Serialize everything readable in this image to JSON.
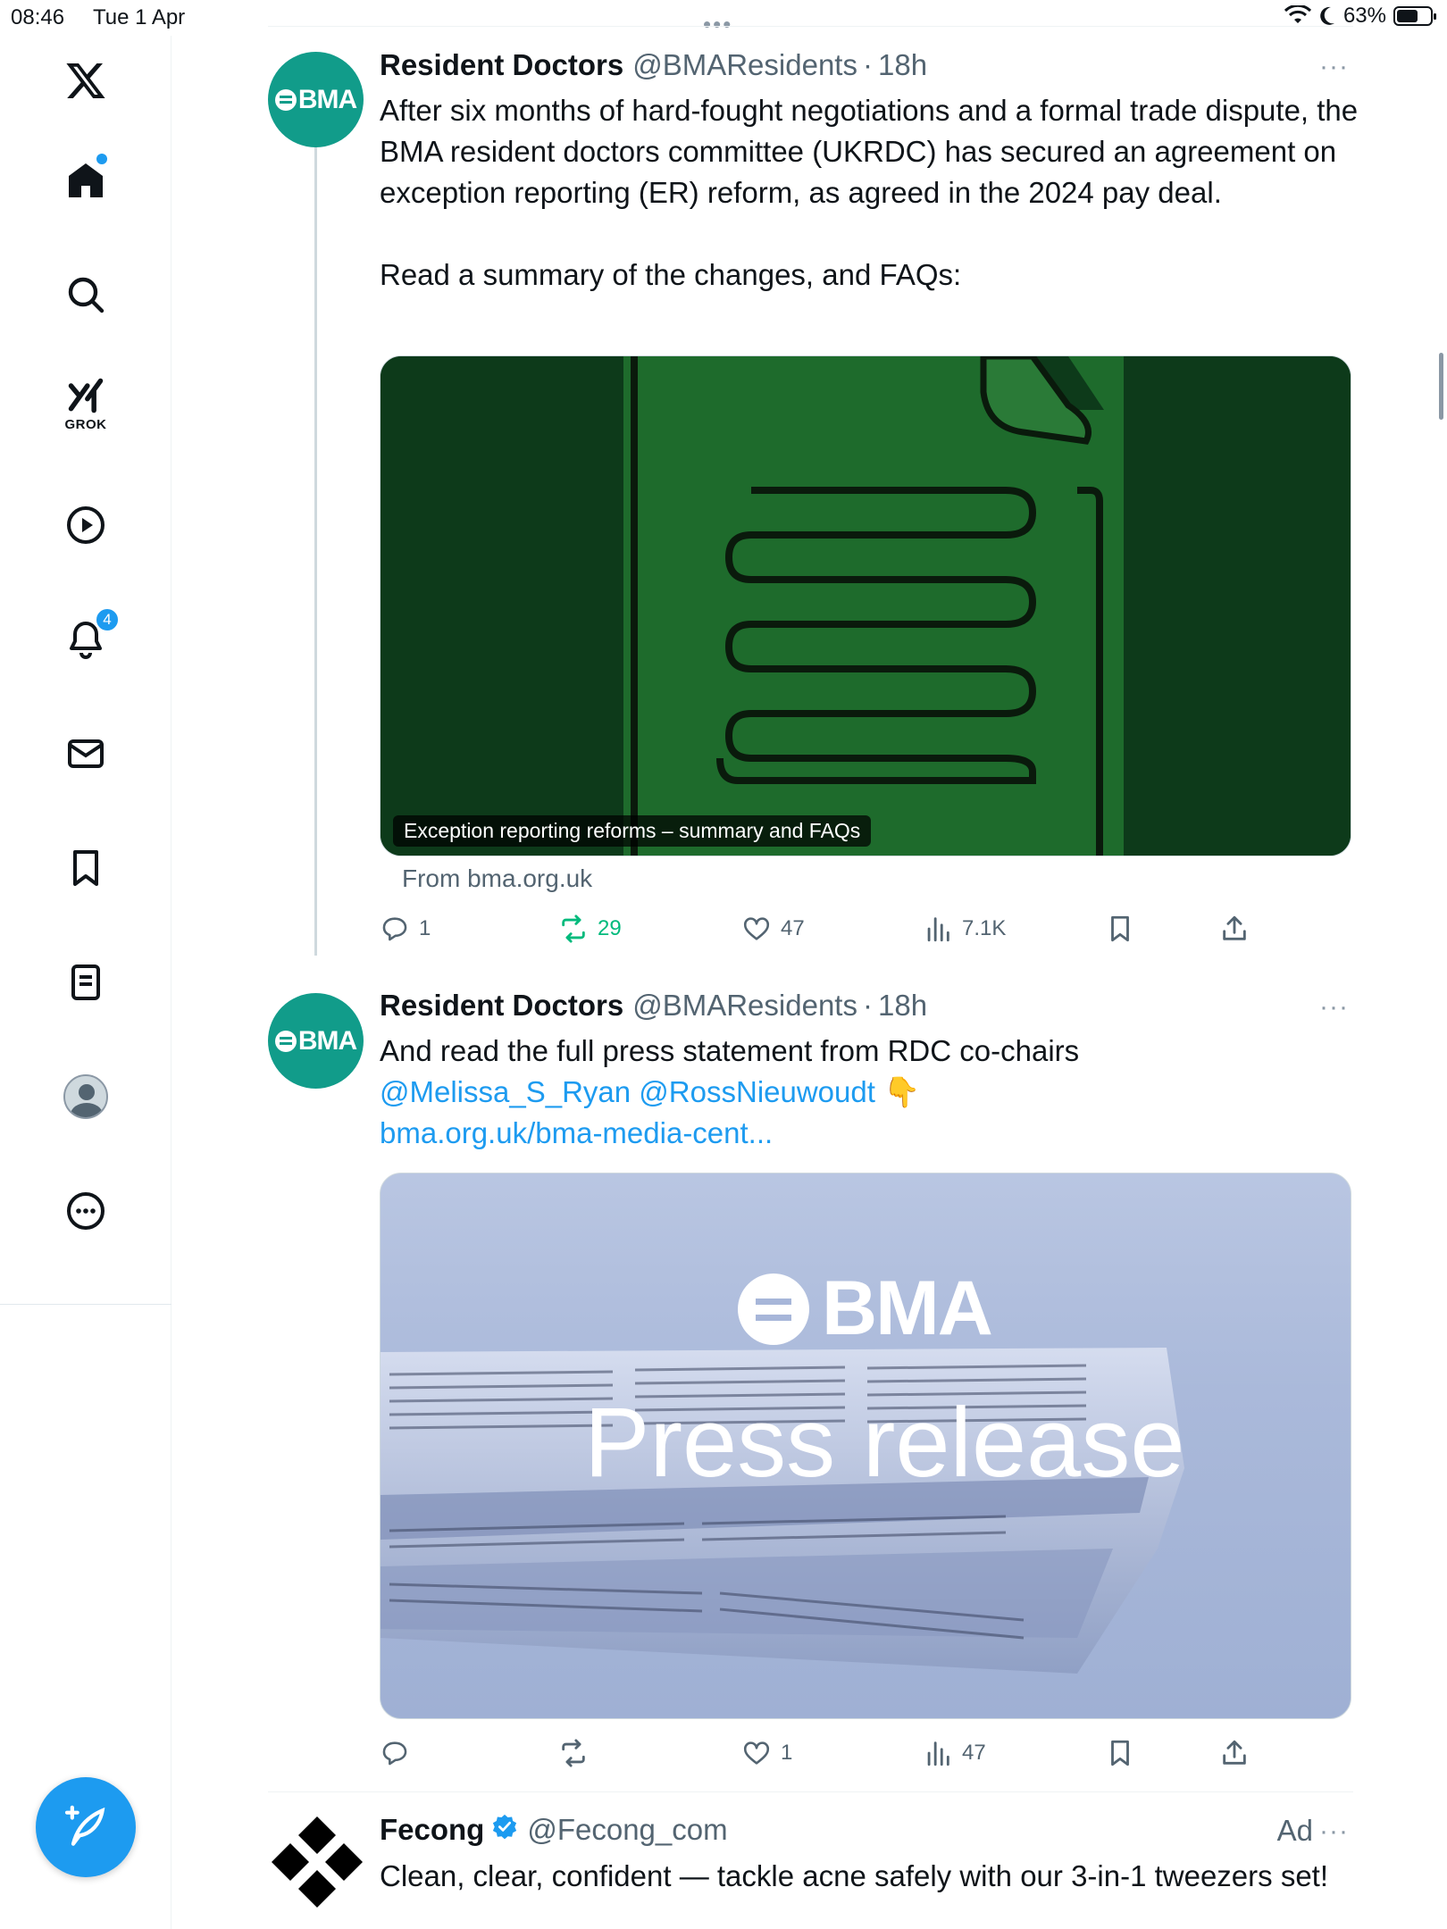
{
  "status": {
    "time": "08:46",
    "date": "Tue 1 Apr",
    "battery": "63%",
    "battery_level": 0.63
  },
  "sidebar": {
    "grok_label": "GROK",
    "notifications_badge": "4"
  },
  "tweets": [
    {
      "avatar_text": "BMA",
      "name": "Resident Doctors",
      "handle": "@BMAResidents",
      "sep": "·",
      "time": "18h",
      "more": "···",
      "text": "After six months of hard-fought negotiations and a formal trade dispute, the BMA resident doctors committee (UKRDC) has secured an agreement on exception reporting (ER) reform, as agreed in the 2024 pay deal.\n\nRead a summary of the changes, and FAQs:",
      "card_caption": "Exception reporting reforms – summary and FAQs",
      "card_source": "From bma.org.uk",
      "replies": "1",
      "reposts": "29",
      "likes": "47",
      "views": "7.1K"
    },
    {
      "avatar_text": "BMA",
      "name": "Resident Doctors",
      "handle": "@BMAResidents",
      "sep": "·",
      "time": "18h",
      "more": "···",
      "text_plain": "And read the full press statement from RDC co-chairs",
      "mention1": "@Melissa_S_Ryan",
      "mention2": "@RossNieuwoudt",
      "emoji": "👇",
      "link": "bma.org.uk/bma-media-cent...",
      "card_logo": "BMA",
      "card_title": "Press release",
      "replies": "",
      "reposts": "",
      "likes": "1",
      "views": "47"
    },
    {
      "name": "Fecong",
      "handle": "@Fecong_com",
      "ad_label": "Ad",
      "more": "···",
      "text": "Clean, clear, confident — tackle acne safely with our 3-in-1 tweezers set!"
    }
  ]
}
